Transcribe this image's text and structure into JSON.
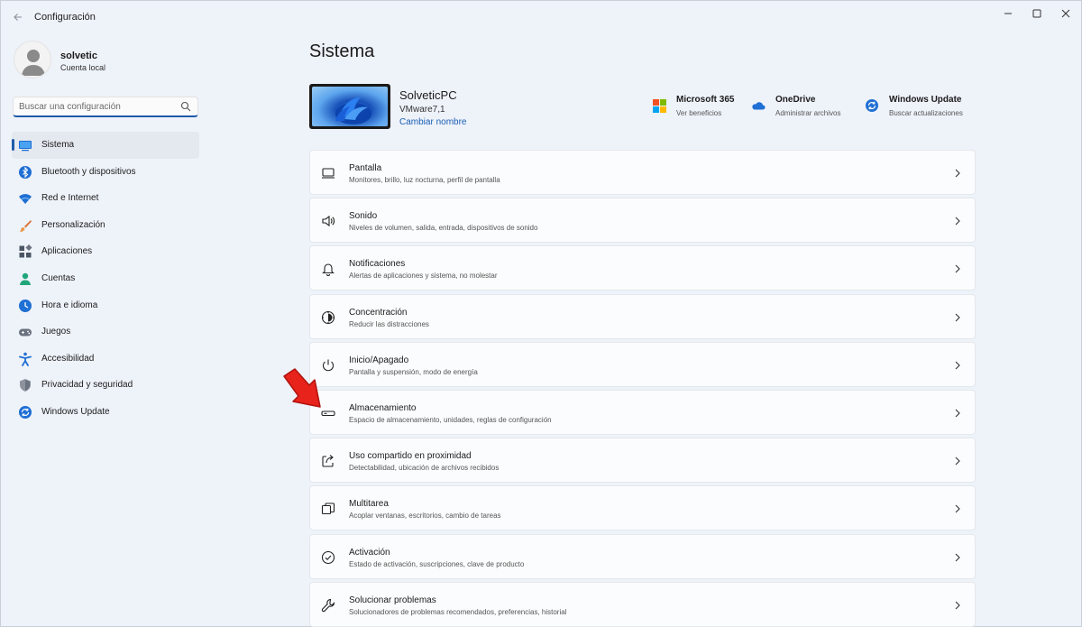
{
  "window": {
    "title": "Configuración"
  },
  "profile": {
    "name": "solvetic",
    "account_type": "Cuenta local"
  },
  "search": {
    "placeholder": "Buscar una configuración"
  },
  "sidebar": {
    "active_index": 0,
    "items": [
      {
        "label": "Sistema",
        "icon": "monitor-icon"
      },
      {
        "label": "Bluetooth y dispositivos",
        "icon": "bluetooth-icon"
      },
      {
        "label": "Red e Internet",
        "icon": "wifi-icon"
      },
      {
        "label": "Personalización",
        "icon": "brush-icon"
      },
      {
        "label": "Aplicaciones",
        "icon": "apps-icon"
      },
      {
        "label": "Cuentas",
        "icon": "person-icon"
      },
      {
        "label": "Hora e idioma",
        "icon": "globe-clock-icon"
      },
      {
        "label": "Juegos",
        "icon": "gamepad-icon"
      },
      {
        "label": "Accesibilidad",
        "icon": "accessibility-icon"
      },
      {
        "label": "Privacidad y seguridad",
        "icon": "shield-icon"
      },
      {
        "label": "Windows Update",
        "icon": "windows-update-icon"
      }
    ]
  },
  "main": {
    "title": "Sistema",
    "device": {
      "name": "SolveticPC",
      "model": "VMware7,1",
      "rename_label": "Cambiar nombre"
    },
    "quick_links": [
      {
        "title": "Microsoft 365",
        "subtitle": "Ver beneficios",
        "icon": "microsoft-logo-icon"
      },
      {
        "title": "OneDrive",
        "subtitle": "Administrar archivos",
        "icon": "onedrive-cloud-icon"
      },
      {
        "title": "Windows Update",
        "subtitle": "Buscar actualizaciones",
        "icon": "windows-update-icon"
      }
    ],
    "settings": [
      {
        "title": "Pantalla",
        "subtitle": "Monitores, brillo, luz nocturna, perfil de pantalla",
        "icon": "display-icon"
      },
      {
        "title": "Sonido",
        "subtitle": "Niveles de volumen, salida, entrada, dispositivos de sonido",
        "icon": "speaker-icon"
      },
      {
        "title": "Notificaciones",
        "subtitle": "Alertas de aplicaciones y sistema, no molestar",
        "icon": "bell-icon"
      },
      {
        "title": "Concentración",
        "subtitle": "Reducir las distracciones",
        "icon": "focus-icon"
      },
      {
        "title": "Inicio/Apagado",
        "subtitle": "Pantalla y suspensión, modo de energía",
        "icon": "power-icon"
      },
      {
        "title": "Almacenamiento",
        "subtitle": "Espacio de almacenamiento, unidades, reglas de configuración",
        "icon": "storage-drive-icon"
      },
      {
        "title": "Uso compartido en proximidad",
        "subtitle": "Detectabilidad, ubicación de archivos recibidos",
        "icon": "share-icon"
      },
      {
        "title": "Multitarea",
        "subtitle": "Acoplar ventanas, escritorios, cambio de tareas",
        "icon": "multitask-icon"
      },
      {
        "title": "Activación",
        "subtitle": "Estado de activación, suscripciones, clave de producto",
        "icon": "checkmark-circle-icon"
      },
      {
        "title": "Solucionar problemas",
        "subtitle": "Solucionadores de problemas recomendados, preferencias, historial",
        "icon": "wrench-icon"
      }
    ]
  },
  "colors": {
    "accent": "#1f5aa8",
    "background": "#eef2f9",
    "card": "#fbfcfd",
    "annotation_arrow": "#e8231c"
  }
}
